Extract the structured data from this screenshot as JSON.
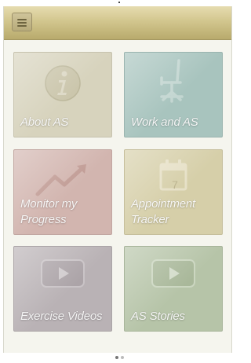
{
  "header": {
    "menu_icon": "hamburger-menu-icon",
    "bar_color": "#d2c68e"
  },
  "tiles": [
    {
      "label": "About AS",
      "icon": "info-icon",
      "color": "#d7d3bd"
    },
    {
      "label": "Work and AS",
      "icon": "office-chair-icon",
      "color": "#a8c4be"
    },
    {
      "label": "Monitor my Progress",
      "icon": "trend-up-arrow-icon",
      "color": "#d2b5af"
    },
    {
      "label": "Appointment Tracker",
      "icon": "calendar-icon",
      "color": "#d6cfa9"
    },
    {
      "label": "Exercise Videos",
      "icon": "play-video-icon",
      "color": "#b9b2b5"
    },
    {
      "label": "AS Stories",
      "icon": "play-video-icon",
      "color": "#b6c4a8"
    }
  ],
  "calendar_day": "7",
  "pager": {
    "pages": 2,
    "current": 1
  }
}
